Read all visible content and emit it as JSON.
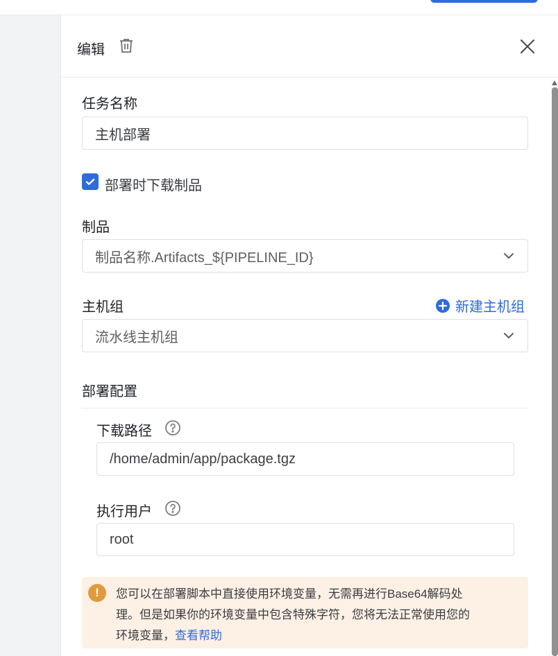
{
  "panel": {
    "title": "编辑"
  },
  "form": {
    "task_name": {
      "label": "任务名称",
      "value": "主机部署"
    },
    "download_artifact": {
      "label": "部署时下载制品",
      "checked": true
    },
    "artifact": {
      "label": "制品",
      "value": "制品名称.Artifacts_${PIPELINE_ID}"
    },
    "host_group": {
      "label": "主机组",
      "value": "流水线主机组",
      "new_label": "新建主机组"
    },
    "deploy_config": {
      "label": "部署配置",
      "download_path": {
        "label": "下载路径",
        "value": "/home/admin/app/package.tgz"
      },
      "exec_user": {
        "label": "执行用户",
        "value": "root"
      }
    }
  },
  "notice": {
    "line1": "您可以在部署脚本中直接使用环境变量，无需再进行Base64解码处",
    "line2": "理。但是如果你的环境变量中包含特殊字符，您将无法正常使用您的",
    "line3": "环境变量，",
    "link": "查看帮助"
  },
  "colors": {
    "accent": "#2f6bdc",
    "warning": "#e09a3e",
    "notice_bg": "#fdf0e5"
  }
}
